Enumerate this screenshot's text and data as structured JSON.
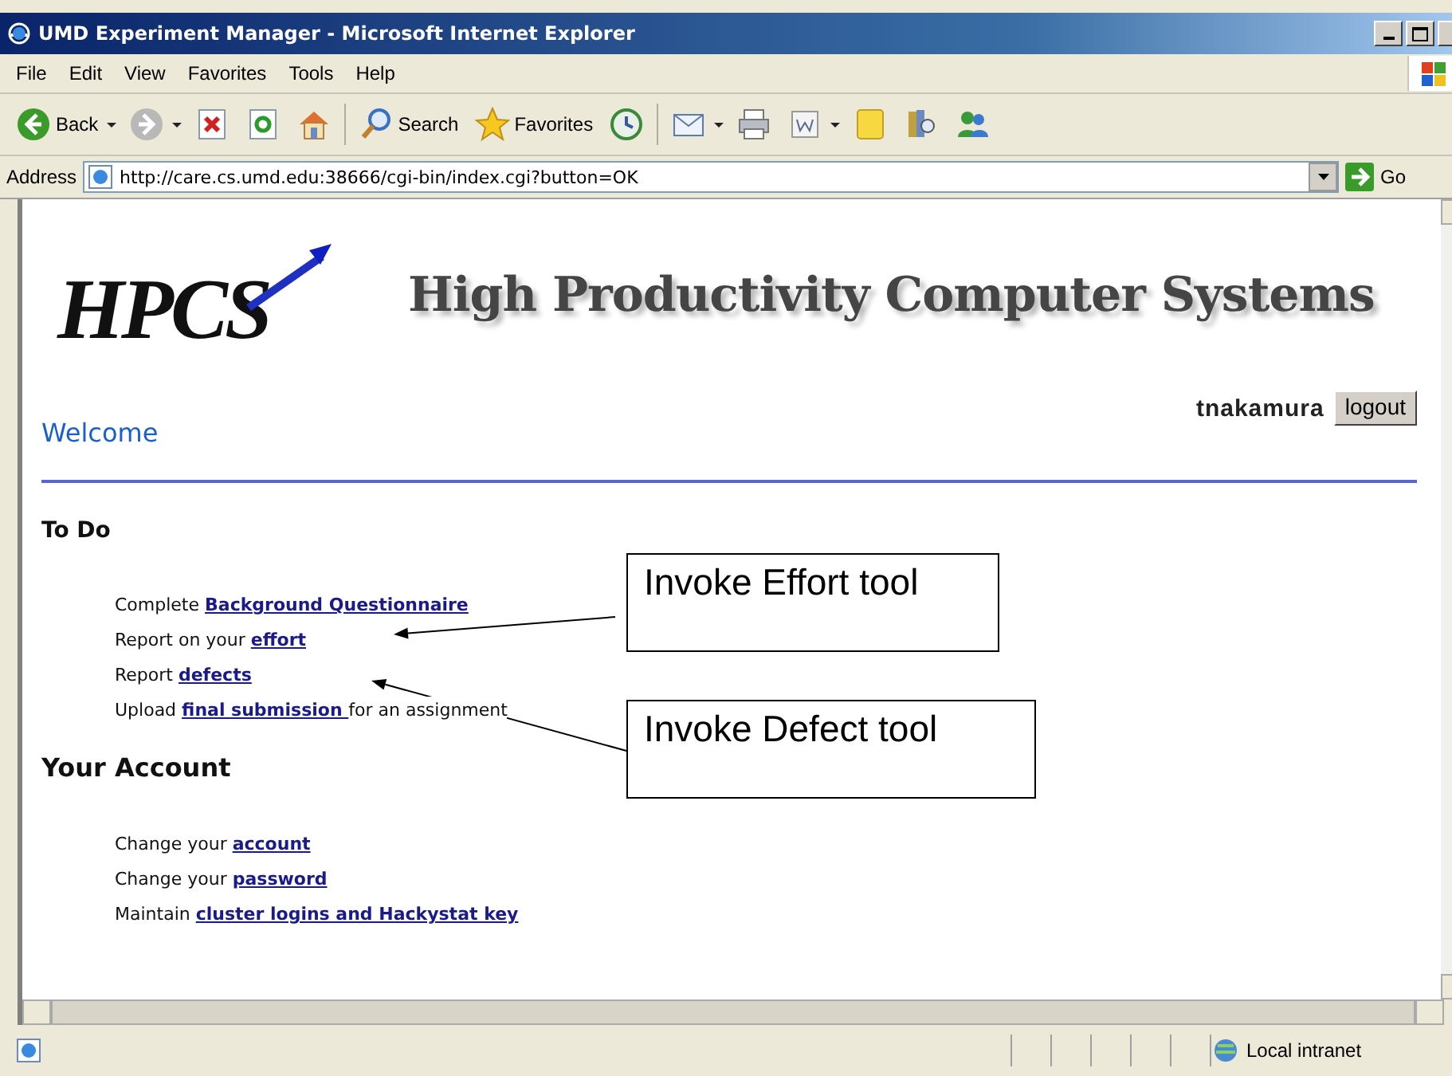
{
  "window": {
    "title": "UMD Experiment Manager - Microsoft Internet Explorer"
  },
  "menu": [
    "File",
    "Edit",
    "View",
    "Favorites",
    "Tools",
    "Help"
  ],
  "toolbar": [
    {
      "kind": "back",
      "label": "Back"
    },
    {
      "kind": "forward"
    },
    {
      "kind": "stop"
    },
    {
      "kind": "refresh"
    },
    {
      "kind": "home"
    },
    {
      "kind": "search",
      "label": "Search"
    },
    {
      "kind": "favorites",
      "label": "Favorites"
    },
    {
      "kind": "history"
    },
    {
      "kind": "mail"
    },
    {
      "kind": "print"
    },
    {
      "kind": "edit"
    },
    {
      "kind": "note"
    },
    {
      "kind": "research"
    },
    {
      "kind": "messenger"
    }
  ],
  "address": {
    "label": "Address",
    "value": "http://care.cs.umd.edu:38666/cgi-bin/index.cgi?button=OK",
    "go": "Go"
  },
  "page": {
    "logo": "HPCS",
    "banner": "High Productivity Computer Systems",
    "user": "tnakamura",
    "logout": "logout",
    "welcome": "Welcome",
    "sections": [
      {
        "heading": "To Do",
        "items": [
          [
            {
              "kind": "text",
              "text": "Complete "
            },
            {
              "kind": "link",
              "text": "Background Questionnaire"
            }
          ],
          [
            {
              "kind": "text",
              "text": "Report on your "
            },
            {
              "kind": "link",
              "text": "effort"
            }
          ],
          [
            {
              "kind": "text",
              "text": "Report "
            },
            {
              "kind": "link",
              "text": "defects"
            }
          ],
          [
            {
              "kind": "text",
              "text": "Upload "
            },
            {
              "kind": "link",
              "text": "final submission "
            },
            {
              "kind": "text",
              "text": "for an assignment"
            }
          ]
        ]
      },
      {
        "heading": "Your Account",
        "items": [
          [
            {
              "kind": "text",
              "text": "Change your "
            },
            {
              "kind": "link",
              "text": "account"
            }
          ],
          [
            {
              "kind": "text",
              "text": "Change your "
            },
            {
              "kind": "link",
              "text": "password"
            }
          ],
          [
            {
              "kind": "text",
              "text": "Maintain "
            },
            {
              "kind": "link",
              "text": "cluster logins and Hackystat key"
            }
          ]
        ]
      }
    ]
  },
  "callouts": [
    "Invoke Effort tool",
    "Invoke Defect tool"
  ],
  "status_bar": {
    "zone": "Local intranet"
  }
}
